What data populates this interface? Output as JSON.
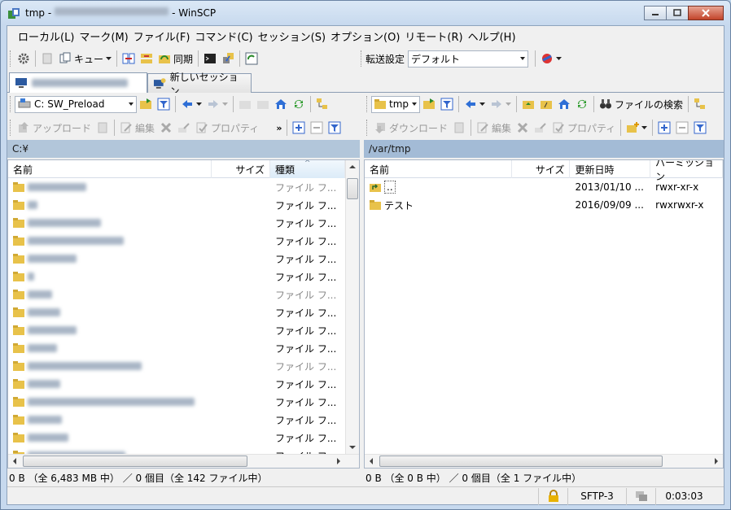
{
  "window": {
    "title_prefix": "tmp -",
    "title_suffix": "- WinSCP",
    "colors": {
      "title_bg": "#c7d9ee",
      "path_active": "#a3bbd6",
      "folder": "#e8c24a"
    }
  },
  "menu": [
    "ローカル(L)",
    "マーク(M)",
    "ファイル(F)",
    "コマンド(C)",
    "セッション(S)",
    "オプション(O)",
    "リモート(R)",
    "ヘルプ(H)"
  ],
  "toolbar": {
    "queue_label": "キュー",
    "sync_label": "同期",
    "transfer_label": "転送設定",
    "transfer_value": "デフォルト"
  },
  "tabs": {
    "new_session": "新しいセッション"
  },
  "local": {
    "drive": "C: SW_Preload",
    "path": "C:¥",
    "buttons": {
      "upload": "アップロード",
      "edit": "編集",
      "properties": "プロパティ"
    },
    "headers": [
      "名前",
      "サイズ",
      "種類"
    ],
    "row_type": "ファイル フ...",
    "status": "0 B （全 6,483 MB 中） ／ 0 個目（全 142 ファイル中）"
  },
  "remote": {
    "folder": "tmp",
    "path": "/var/tmp",
    "find_label": "ファイルの検索",
    "buttons": {
      "download": "ダウンロード",
      "edit": "編集",
      "properties": "プロパティ"
    },
    "headers": [
      "名前",
      "サイズ",
      "更新日時",
      "パーミッション"
    ],
    "rows": [
      {
        "name": "..",
        "date": "2013/01/10 ...",
        "perm": "rwxr-xr-x"
      },
      {
        "name": "テスト",
        "date": "2016/09/09 ...",
        "perm": "rwxrwxr-x"
      }
    ],
    "status": "0 B （全 0 B 中） ／ 0 個目（全 1 ファイル中）"
  },
  "statusbar": {
    "protocol": "SFTP-3",
    "time": "0:03:03"
  }
}
